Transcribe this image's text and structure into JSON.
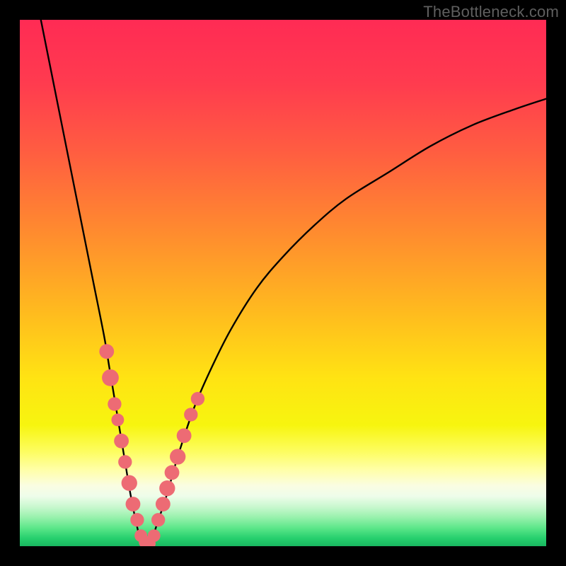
{
  "watermark": "TheBottleneck.com",
  "chart_data": {
    "type": "line",
    "title": "",
    "xlabel": "",
    "ylabel": "",
    "xlim": [
      0,
      100
    ],
    "ylim": [
      0,
      100
    ],
    "series": [
      {
        "name": "bottleneck-curve",
        "x": [
          4,
          6,
          8,
          10,
          12,
          14,
          16,
          17,
          18,
          19,
          20,
          21,
          22,
          23,
          24,
          25,
          26,
          28,
          30,
          33,
          36,
          40,
          45,
          50,
          56,
          62,
          70,
          78,
          86,
          94,
          100
        ],
        "values": [
          100,
          90,
          80,
          70,
          60,
          50,
          40,
          34,
          28,
          22,
          16,
          10,
          5,
          1,
          0.3,
          1,
          4,
          10,
          17,
          26,
          33,
          41,
          49,
          55,
          61,
          66,
          71,
          76,
          80,
          83,
          85
        ]
      }
    ],
    "markers": {
      "name": "highlighted-points",
      "color": "#ed6b74",
      "points": [
        {
          "x": 16.5,
          "y": 37,
          "r": 1.4
        },
        {
          "x": 17.2,
          "y": 32,
          "r": 1.6
        },
        {
          "x": 18.0,
          "y": 27,
          "r": 1.3
        },
        {
          "x": 18.6,
          "y": 24,
          "r": 1.2
        },
        {
          "x": 19.3,
          "y": 20,
          "r": 1.4
        },
        {
          "x": 20.0,
          "y": 16,
          "r": 1.3
        },
        {
          "x": 20.8,
          "y": 12,
          "r": 1.5
        },
        {
          "x": 21.5,
          "y": 8,
          "r": 1.4
        },
        {
          "x": 22.3,
          "y": 5,
          "r": 1.3
        },
        {
          "x": 23.0,
          "y": 2,
          "r": 1.2
        },
        {
          "x": 23.8,
          "y": 0.8,
          "r": 1.2
        },
        {
          "x": 24.6,
          "y": 0.5,
          "r": 1.2
        },
        {
          "x": 25.5,
          "y": 2,
          "r": 1.2
        },
        {
          "x": 26.3,
          "y": 5,
          "r": 1.3
        },
        {
          "x": 27.2,
          "y": 8,
          "r": 1.4
        },
        {
          "x": 28.0,
          "y": 11,
          "r": 1.5
        },
        {
          "x": 28.9,
          "y": 14,
          "r": 1.4
        },
        {
          "x": 30.0,
          "y": 17,
          "r": 1.5
        },
        {
          "x": 31.2,
          "y": 21,
          "r": 1.4
        },
        {
          "x": 32.5,
          "y": 25,
          "r": 1.3
        },
        {
          "x": 33.8,
          "y": 28,
          "r": 1.3
        }
      ]
    },
    "gradient_stops": [
      {
        "offset": 0.0,
        "color": "#ff2b54"
      },
      {
        "offset": 0.12,
        "color": "#ff3b4f"
      },
      {
        "offset": 0.25,
        "color": "#ff5d41"
      },
      {
        "offset": 0.4,
        "color": "#ff8a2f"
      },
      {
        "offset": 0.55,
        "color": "#ffb91f"
      },
      {
        "offset": 0.68,
        "color": "#ffe313"
      },
      {
        "offset": 0.77,
        "color": "#f7f50f"
      },
      {
        "offset": 0.82,
        "color": "#fdfd60"
      },
      {
        "offset": 0.855,
        "color": "#ffffa8"
      },
      {
        "offset": 0.885,
        "color": "#fafde2"
      },
      {
        "offset": 0.905,
        "color": "#eefdea"
      },
      {
        "offset": 0.925,
        "color": "#c9f8cf"
      },
      {
        "offset": 0.945,
        "color": "#99f1ad"
      },
      {
        "offset": 0.965,
        "color": "#5de78a"
      },
      {
        "offset": 0.985,
        "color": "#26cf6d"
      },
      {
        "offset": 1.0,
        "color": "#19b760"
      }
    ]
  }
}
